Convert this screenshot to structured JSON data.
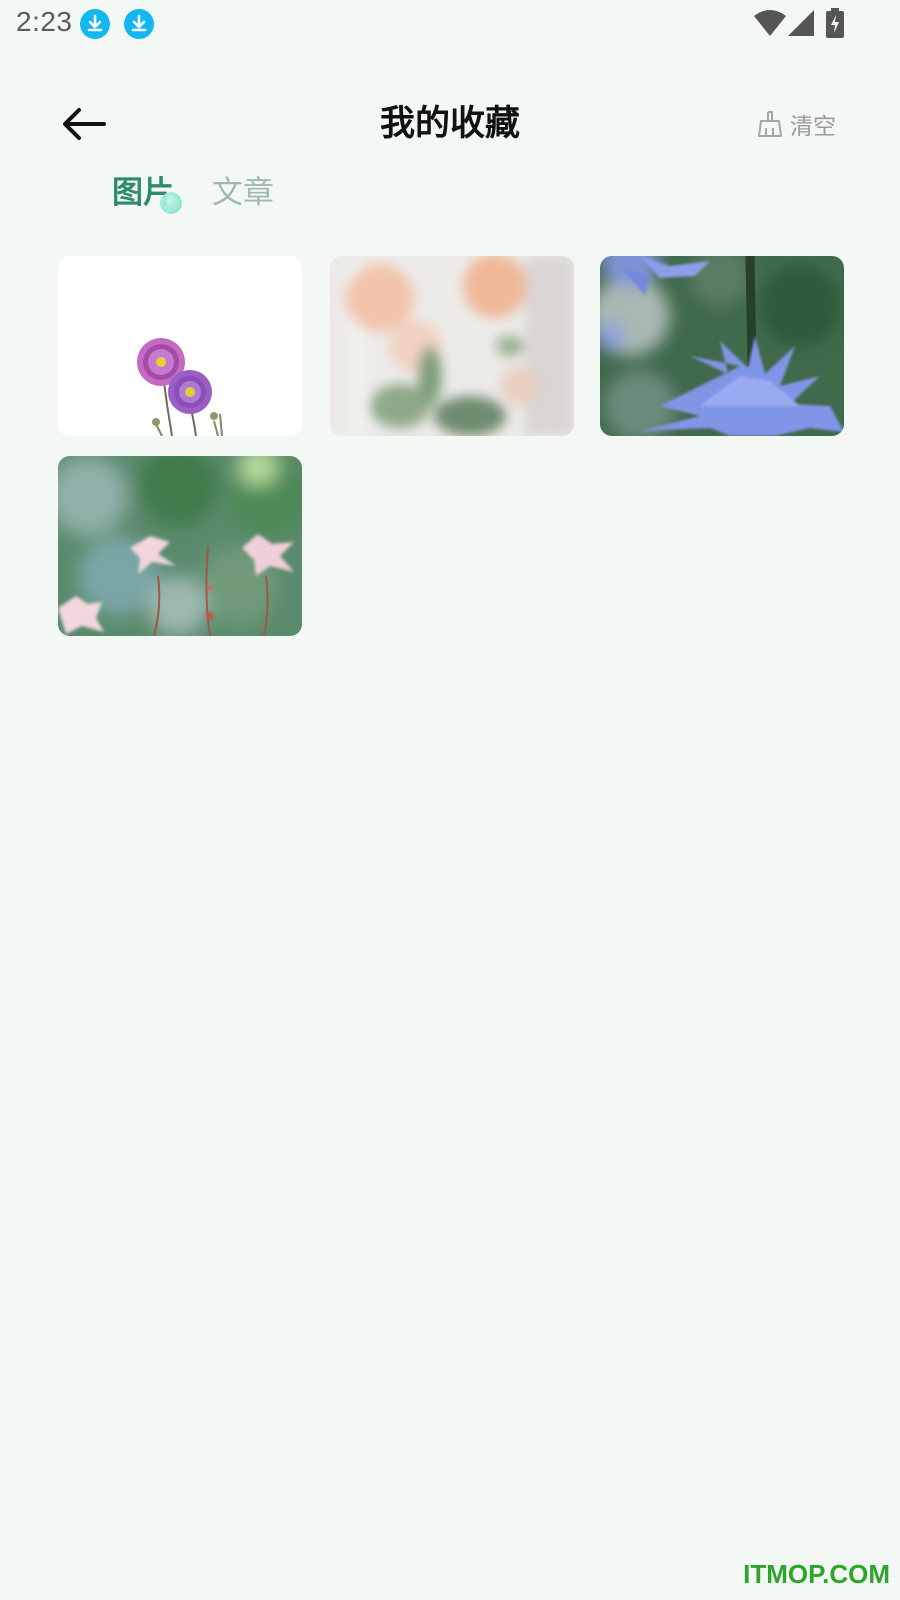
{
  "status_bar": {
    "time": "2:23",
    "icons": [
      "download-icon",
      "download-icon",
      "wifi-icon",
      "signal-icon",
      "battery-charging-icon"
    ]
  },
  "header": {
    "back_icon": "arrow-left-icon",
    "title": "我的收藏",
    "clear_icon": "broom-icon",
    "clear_label": "清空"
  },
  "tabs": [
    {
      "label": "图片",
      "active": true
    },
    {
      "label": "文章",
      "active": false
    }
  ],
  "gallery": {
    "items": [
      {
        "subject": "pink-cosmos-flowers"
      },
      {
        "subject": "peach-roses"
      },
      {
        "subject": "blue-chicory-flower"
      },
      {
        "subject": "pink-wildflowers"
      }
    ]
  },
  "colors": {
    "background": "#f3f8f5",
    "tab_active": "#2f8c6a",
    "tab_inactive": "#9fb8b0",
    "download_badge": "#12b8ef"
  },
  "watermark": "ITMOP.COM"
}
